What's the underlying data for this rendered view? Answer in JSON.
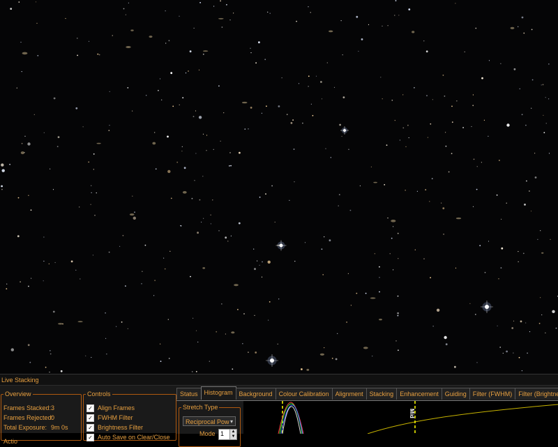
{
  "panel": {
    "title": "Live Stacking",
    "overview": {
      "legend": "Overview",
      "frames_stacked_label": "Frames Stacked:",
      "frames_stacked_value": "3",
      "frames_rejected_label": "Frames Rejected:",
      "frames_rejected_value": "0",
      "total_exposure_label": "Total Exposure:",
      "total_exposure_value": "9m 0s"
    },
    "controls": {
      "legend": "Controls",
      "items": [
        {
          "label": "Align Frames",
          "checked": true
        },
        {
          "label": "FWHM Filter",
          "checked": true
        },
        {
          "label": "Brightness Filter",
          "checked": true
        },
        {
          "label": "Auto Save on Clear/Close",
          "checked": true
        }
      ],
      "partial_label": "Actio"
    },
    "tabs": [
      "Status",
      "Histogram",
      "Background",
      "Colour Calibration",
      "Alignment",
      "Stacking",
      "Enhancement",
      "Guiding",
      "Filter (FWHM)",
      "Filter (Brightness)"
    ],
    "active_tab": "Histogram",
    "histogram": {
      "stretch_legend": "Stretch Type",
      "stretch_value": "Reciprocal Pow",
      "mode_label": "Mode",
      "mode_value": "1",
      "mid_label": "Mid",
      "colors": {
        "red": "#ff4040",
        "green": "#40ff40",
        "blue": "#4060ff",
        "lum": "#ffffff",
        "marker": "#ffff00",
        "curve": "#c8b400"
      }
    }
  },
  "colors": {
    "accent": "#e8a040",
    "border": "#b05a10",
    "panel_bg": "#1a1a1a"
  }
}
